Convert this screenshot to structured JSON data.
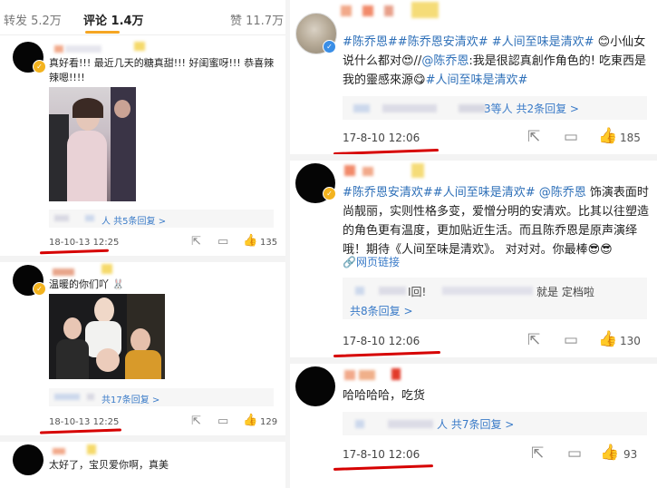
{
  "tabs": {
    "repost": "转发 5.2万",
    "comments": "评论 1.4万",
    "likes": "赞 11.7万"
  },
  "left_comments": [
    {
      "text": "真好看!!! 最近几天的糖真甜!!! 好闺蜜呀!!! 恭喜辣辣嗯!!!!",
      "reply_label": "人 共5条回复 >",
      "time": "18-10-13 12:25",
      "likes": "135"
    },
    {
      "text": "温暖的你们吖",
      "reply_label": "共17条回复 >",
      "time": "18-10-13 12:25",
      "likes": "129"
    },
    {
      "text": "太好了，宝贝爱你啊，真美"
    }
  ],
  "right_comments": [
    {
      "text_parts": [
        "#陈乔恩#",
        "#陈乔恩安清欢#",
        "#人间至味是清欢#",
        " 😊小仙女说什么都对😍//",
        "@陈乔恩",
        ":我是很認真創作角色的! 吃東西是我的靈感來源😋",
        "#人间至味是清欢#"
      ],
      "reply_label": "3等人 共2条回复 >",
      "time": "17-8-10 12:06",
      "likes": "185"
    },
    {
      "text_parts": [
        "#陈乔恩安清欢#",
        "#人间至味是清欢#",
        "@陈乔恩",
        " 饰演表面时尚靓丽，实则性格多变，爱憎分明的安清欢。比其以往塑造的角色更有温度，更加贴近生活。而且陈乔恩是原声演绎哦！期待《人间至味是清欢》。   对对对。你最棒😎😎"
      ],
      "web_link": "网页链接",
      "reply_fragments": [
        "I回!",
        "就是 定档啦"
      ],
      "reply_label": "共8条回复 >",
      "time": "17-8-10 12:06",
      "likes": "130"
    },
    {
      "text": "哈哈哈哈，吃货",
      "reply_label": "人 共7条回复 >",
      "time": "17-8-10 12:06",
      "likes": "93"
    }
  ],
  "colors": {
    "accent": "#f5a623",
    "link": "#3a7bc8",
    "hashtag": "#2d6fb8",
    "annotation": "#d60000"
  },
  "icons": [
    "share-icon",
    "comment-icon",
    "thumbs-up-icon",
    "verified-icon",
    "link-icon"
  ]
}
